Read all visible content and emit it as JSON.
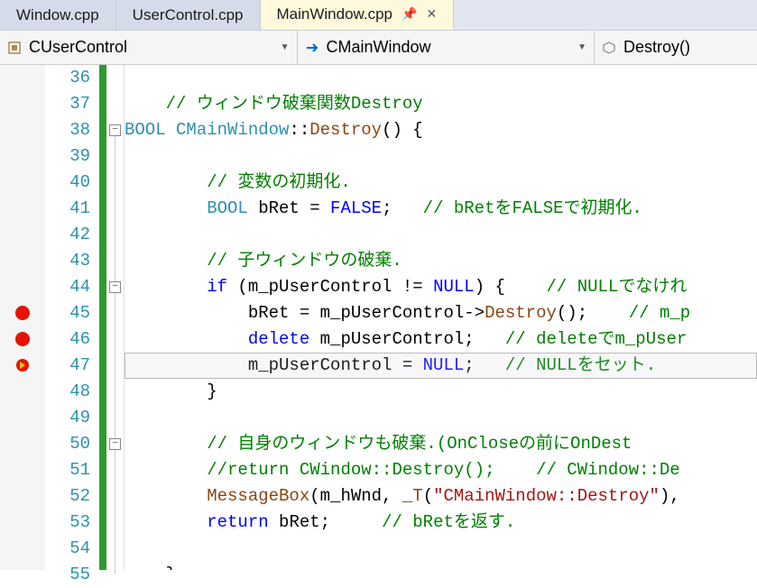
{
  "tabs": {
    "t1": "Window.cpp",
    "t2": "UserControl.cpp",
    "t3": "MainWindow.cpp"
  },
  "nav": {
    "scope": "CUserControl",
    "class": "CMainWindow",
    "member": "Destroy()"
  },
  "gutter": {
    "start": 36,
    "end": 55
  },
  "code": {
    "l36": {
      "indent": "    ",
      "parts": []
    },
    "l37": {
      "indent": "    ",
      "comment": "// ウィンドウ破棄関数Destroy"
    },
    "l38": {
      "text_pre": "",
      "kw": "BOOL",
      "sp1": " ",
      "type": "CMainWindow",
      "op": "::",
      "func": "Destroy",
      "rest": "() {"
    },
    "l39": {
      "indent": "    ",
      "parts": []
    },
    "l40": {
      "indent": "        ",
      "comment": "// 変数の初期化."
    },
    "l41": {
      "indent": "        ",
      "kw1": "BOOL",
      "sp1": " bRet = ",
      "kw2": "FALSE",
      "rest": ";   ",
      "comment": "// bRetをFALSEで初期化."
    },
    "l42": {
      "indent": "    ",
      "parts": []
    },
    "l43": {
      "indent": "        ",
      "comment": "// 子ウィンドウの破棄."
    },
    "l44": {
      "indent": "        ",
      "kw": "if",
      "rest": " (m_pUserControl != ",
      "kw2": "NULL",
      "rest2": ") {    ",
      "comment": "// NULLでなけれ"
    },
    "l45": {
      "indent": "            ",
      "pre": "bRet = m_pUserControl->",
      "func": "Destroy",
      "rest": "();    ",
      "comment": "// m_p"
    },
    "l46": {
      "indent": "            ",
      "kw": "delete",
      "rest": " m_pUserControl;   ",
      "comment": "// deleteでm_pUser"
    },
    "l47": {
      "indent": "            ",
      "pre": "m_pUserControl = ",
      "kw": "NULL",
      "rest": ";   ",
      "comment": "// NULLをセット. "
    },
    "l48": {
      "indent": "        ",
      "rest": "}"
    },
    "l49": {
      "indent": "    ",
      "parts": []
    },
    "l50": {
      "indent": "        ",
      "comment": "// 自身のウィンドウも破棄.(OnCloseの前にOnDest"
    },
    "l51": {
      "indent": "        ",
      "comment": "//return CWindow::Destroy();    // CWindow::De"
    },
    "l52": {
      "indent": "        ",
      "func": "MessageBox",
      "rest": "(m_hWnd, ",
      "func2": "_T",
      "rest2": "(",
      "str": "\"CMainWindow::Destroy\"",
      "rest3": "), "
    },
    "l53": {
      "indent": "        ",
      "kw": "return",
      "rest": " bRet;     ",
      "comment": "// bRetを返す."
    },
    "l54": {
      "indent": "    ",
      "parts": []
    },
    "l55": {
      "indent": "    ",
      "rest": "}"
    }
  },
  "breakpoints": [
    45,
    46
  ],
  "current_line": 47,
  "fold_boxes": [
    {
      "line": 38,
      "symbol": "-"
    },
    {
      "line": 44,
      "symbol": "-"
    },
    {
      "line": 50,
      "symbol": "-"
    }
  ]
}
